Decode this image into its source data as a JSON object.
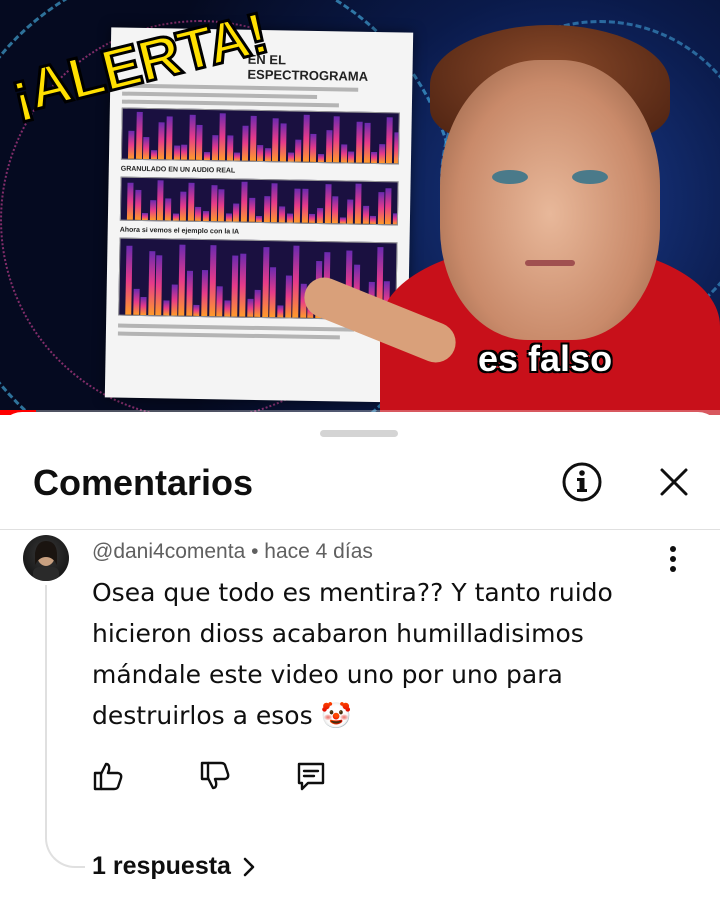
{
  "video": {
    "overlay_title": "¡ALERTA!",
    "overlay_caption": "es falso",
    "doc_heading": "EN EL ESPECTROGRAMA",
    "doc_section_1": "GRANULADO EN UN AUDIO REAL",
    "doc_section_2": "Ahora si vemos el ejemplo con la IA",
    "progress_fraction": 0.05
  },
  "comments_panel": {
    "title": "Comentarios",
    "info_icon": "info-icon",
    "close_icon": "close-icon"
  },
  "comment": {
    "author": "@dani4comenta",
    "separator": "•",
    "time": "hace 4 días",
    "text": "Osea que todo es mentira?? Y tanto ruido hicieron dioss acabaron humilladisimos mándale este video uno por uno para destruirlos a esos 🤡",
    "actions": {
      "like_icon": "thumbs-up-icon",
      "dislike_icon": "thumbs-down-icon",
      "reply_icon": "reply-comment-icon"
    },
    "replies_label": "1 respuesta",
    "replies_chevron": "›"
  },
  "colors": {
    "accent_red": "#ff0000",
    "text_primary": "#0f0f0f",
    "text_secondary": "#606060"
  }
}
